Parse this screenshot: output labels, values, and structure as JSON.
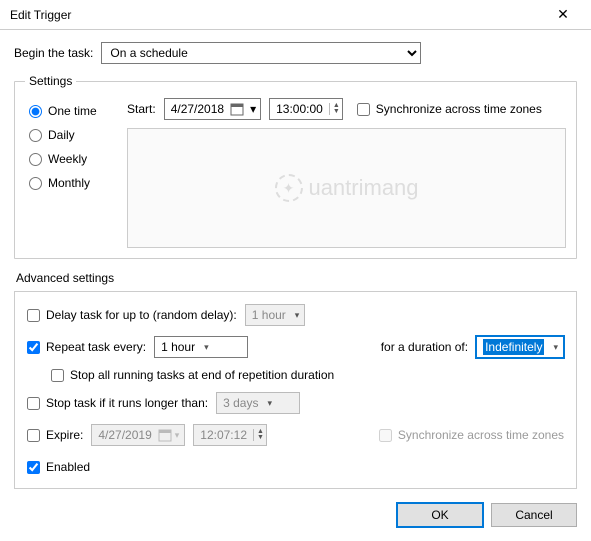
{
  "title": "Edit Trigger",
  "beginLabel": "Begin the task:",
  "beginValue": "On a schedule",
  "settingsLegend": "Settings",
  "schedule": {
    "options": {
      "one": "One time",
      "daily": "Daily",
      "weekly": "Weekly",
      "monthly": "Monthly"
    },
    "selected": "one",
    "startLabel": "Start:",
    "date": "4/27/2018",
    "time": "13:00:00",
    "syncLabel": "Synchronize across time zones",
    "syncChecked": false
  },
  "advancedLabel": "Advanced settings",
  "advanced": {
    "delay": {
      "checked": false,
      "label": "Delay task for up to (random delay):",
      "value": "1 hour"
    },
    "repeat": {
      "checked": true,
      "label": "Repeat task every:",
      "value": "1 hour",
      "durationLabel": "for a duration of:",
      "durationValue": "Indefinitely"
    },
    "stopAtEnd": {
      "checked": false,
      "label": "Stop all running tasks at end of repetition duration"
    },
    "stopIfLonger": {
      "checked": false,
      "label": "Stop task if it runs longer than:",
      "value": "3 days"
    },
    "expire": {
      "checked": false,
      "label": "Expire:",
      "date": "4/27/2019",
      "time": "12:07:12",
      "syncLabel": "Synchronize across time zones",
      "syncChecked": false
    },
    "enabled": {
      "checked": true,
      "label": "Enabled"
    }
  },
  "buttons": {
    "ok": "OK",
    "cancel": "Cancel"
  },
  "watermark": "uantrimang"
}
